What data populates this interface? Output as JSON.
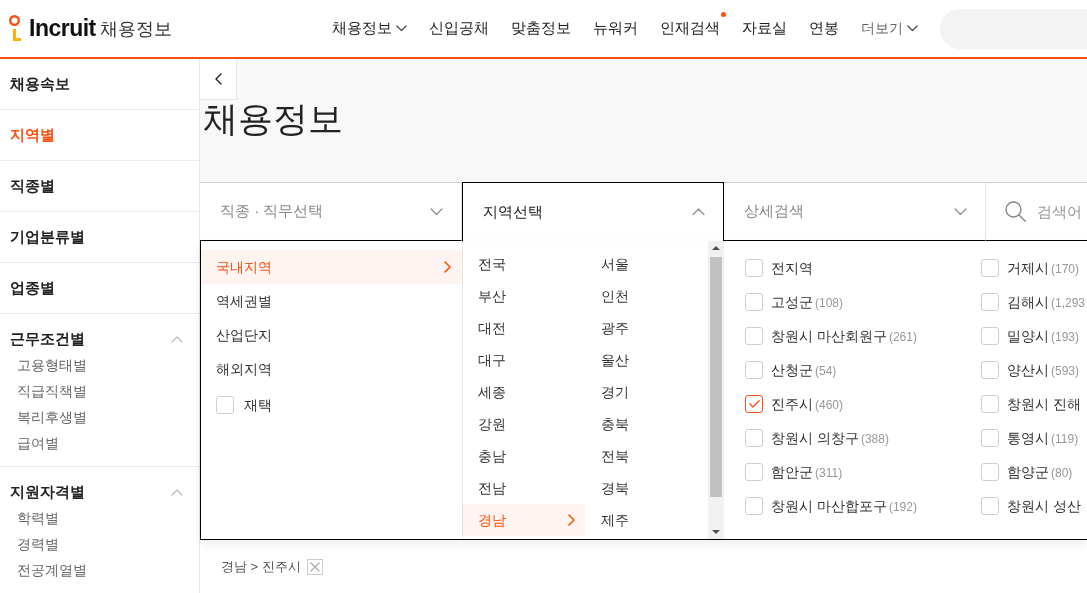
{
  "header": {
    "logo": {
      "name": "Incruit",
      "section": "채용정보"
    },
    "nav": [
      {
        "label": "채용정보",
        "kind": "dropdown",
        "new": false
      },
      {
        "label": "신입공채",
        "kind": "link",
        "new": false
      },
      {
        "label": "맞춤정보",
        "kind": "link",
        "new": false
      },
      {
        "label": "뉴워커",
        "kind": "link",
        "new": false
      },
      {
        "label": "인재검색",
        "kind": "link",
        "new": true
      },
      {
        "label": "자료실",
        "kind": "link",
        "new": false
      },
      {
        "label": "연봉",
        "kind": "link",
        "new": false
      },
      {
        "label": "더보기",
        "kind": "more",
        "new": false
      }
    ]
  },
  "sidebar": {
    "items": [
      {
        "label": "채용속보",
        "kind": "link",
        "selected": false
      },
      {
        "label": "지역별",
        "kind": "link",
        "selected": true
      },
      {
        "label": "직종별",
        "kind": "link",
        "selected": false
      },
      {
        "label": "기업분류별",
        "kind": "link",
        "selected": false
      },
      {
        "label": "업종별",
        "kind": "link",
        "selected": false
      },
      {
        "label": "근무조건별",
        "kind": "group",
        "selected": false,
        "expanded": true,
        "children": [
          {
            "label": "고용형태별",
            "selected": false
          },
          {
            "label": "직급직책별",
            "selected": false
          },
          {
            "label": "복리후생별",
            "selected": false
          },
          {
            "label": "급여별",
            "selected": false
          }
        ]
      },
      {
        "label": "지원자격별",
        "kind": "group",
        "selected": false,
        "expanded": true,
        "children": [
          {
            "label": "학력별",
            "selected": false
          },
          {
            "label": "경력별",
            "selected": false
          },
          {
            "label": "전공계열별",
            "selected": false
          }
        ]
      }
    ]
  },
  "page_title": "채용정보",
  "search_bar": {
    "tabs": [
      {
        "label": "직종 · 직무선택",
        "selected": false
      },
      {
        "label": "지역선택",
        "selected": true
      },
      {
        "label": "상세검색",
        "selected": false
      }
    ],
    "keyword": {
      "placeholder": "검색어"
    }
  },
  "region_panel": {
    "categories": [
      {
        "label": "국내지역",
        "kind": "link",
        "selected": true
      },
      {
        "label": "역세권별",
        "kind": "link",
        "selected": false
      },
      {
        "label": "산업단지",
        "kind": "link",
        "selected": false
      },
      {
        "label": "해외지역",
        "kind": "link",
        "selected": false
      },
      {
        "label": "재택",
        "kind": "checkbox",
        "checked": false
      }
    ],
    "regions": [
      {
        "label": "전국",
        "selected": false
      },
      {
        "label": "서울",
        "selected": false
      },
      {
        "label": "부산",
        "selected": false
      },
      {
        "label": "인천",
        "selected": false
      },
      {
        "label": "대전",
        "selected": false
      },
      {
        "label": "광주",
        "selected": false
      },
      {
        "label": "대구",
        "selected": false
      },
      {
        "label": "울산",
        "selected": false
      },
      {
        "label": "세종",
        "selected": false
      },
      {
        "label": "경기",
        "selected": false
      },
      {
        "label": "강원",
        "selected": false
      },
      {
        "label": "충북",
        "selected": false
      },
      {
        "label": "충남",
        "selected": false
      },
      {
        "label": "전북",
        "selected": false
      },
      {
        "label": "전남",
        "selected": false
      },
      {
        "label": "경북",
        "selected": false
      },
      {
        "label": "경남",
        "selected": true
      },
      {
        "label": "제주",
        "selected": false
      }
    ],
    "districts": [
      {
        "name": "전지역",
        "checked": false
      },
      {
        "name": "거제시",
        "count": "(170)",
        "checked": false
      },
      {
        "name": "고성군",
        "count": "(108)",
        "checked": false
      },
      {
        "name": "김해시",
        "count": "(1,293",
        "checked": false
      },
      {
        "name": "창원시 마산회원구",
        "count": "(261)",
        "checked": false
      },
      {
        "name": "밀양시",
        "count": "(193)",
        "checked": false
      },
      {
        "name": "산청군",
        "count": "(54)",
        "checked": false
      },
      {
        "name": "양산시",
        "count": "(593)",
        "checked": false
      },
      {
        "name": "진주시",
        "count": "(460)",
        "checked": true
      },
      {
        "name": "창원시 진해",
        "checked": false
      },
      {
        "name": "창원시 의창구",
        "count": "(388)",
        "checked": false
      },
      {
        "name": "통영시",
        "count": "(119)",
        "checked": false
      },
      {
        "name": "함안군",
        "count": "(311)",
        "checked": false
      },
      {
        "name": "함양군",
        "count": "(80)",
        "checked": false
      },
      {
        "name": "창원시 마산합포구",
        "count": "(192)",
        "checked": false
      },
      {
        "name": "창원시 성산",
        "checked": false
      }
    ]
  },
  "selected_filters": [
    {
      "label": "경남 > 진주시"
    }
  ]
}
